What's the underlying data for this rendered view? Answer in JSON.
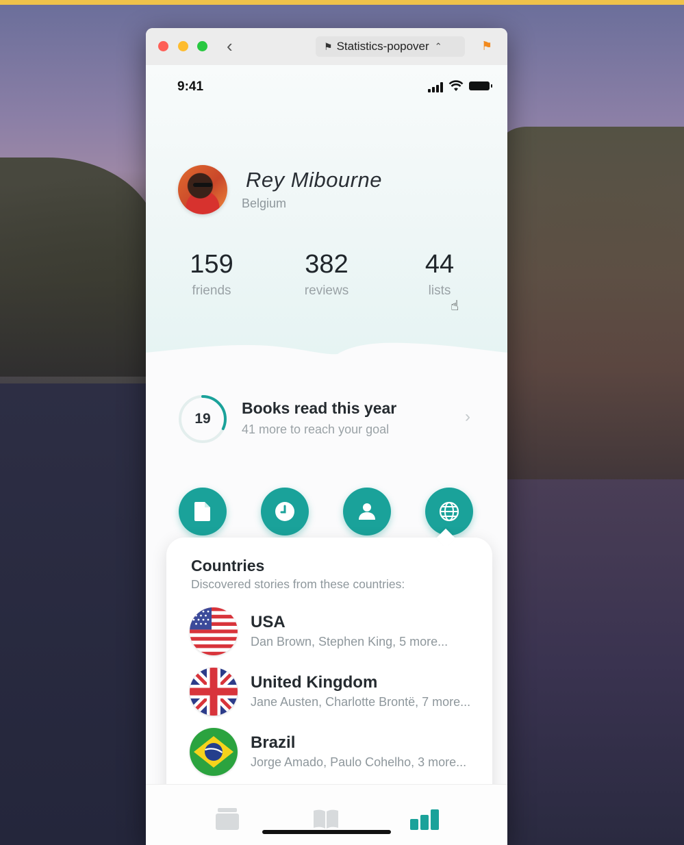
{
  "window": {
    "scheme_label": "Statistics-popover",
    "back_icon": "chevron-left-icon",
    "flag_color": "#f28a1e"
  },
  "status_bar": {
    "time": "9:41"
  },
  "profile": {
    "name": "Rey Mibourne",
    "country": "Belgium"
  },
  "stats": [
    {
      "value": "159",
      "label": "friends"
    },
    {
      "value": "382",
      "label": "reviews"
    },
    {
      "value": "44",
      "label": "lists"
    }
  ],
  "books": {
    "count": "19",
    "title": "Books read this year",
    "subtitle": "41 more to reach your goal",
    "progress_fraction": 0.32
  },
  "action_buttons": [
    {
      "icon": "document-icon"
    },
    {
      "icon": "clock-icon"
    },
    {
      "icon": "person-icon"
    },
    {
      "icon": "globe-icon"
    }
  ],
  "popover": {
    "title": "Countries",
    "subtitle": "Discovered stories from these countries:",
    "countries": [
      {
        "name": "USA",
        "authors": "Dan Brown, Stephen King, 5 more...",
        "flag": "us-flag-icon"
      },
      {
        "name": "United Kingdom",
        "authors": "Jane Austen, Charlotte Brontë, 7 more...",
        "flag": "uk-flag-icon"
      },
      {
        "name": "Brazil",
        "authors": "Jorge Amado, Paulo Cohelho, 3 more...",
        "flag": "brazil-flag-icon"
      }
    ]
  },
  "tab_bar": {
    "tabs": [
      {
        "icon": "stack-icon",
        "active": false
      },
      {
        "icon": "book-icon",
        "active": false
      },
      {
        "icon": "bar-chart-icon",
        "active": true
      }
    ]
  },
  "colors": {
    "accent": "#1aa29a",
    "text_primary": "#252b30",
    "text_secondary": "#8e979c"
  }
}
